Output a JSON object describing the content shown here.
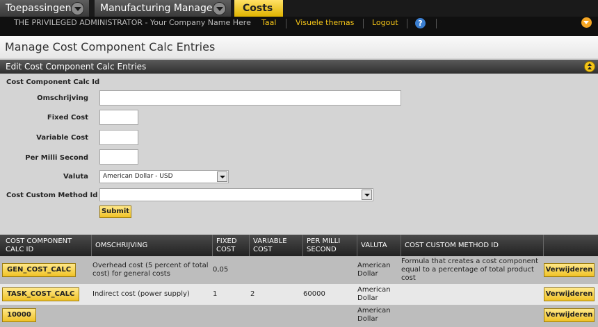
{
  "top_tabs": [
    {
      "label": "Toepassingen"
    },
    {
      "label": "Manufacturing Manager"
    },
    {
      "label": "Costs"
    }
  ],
  "header": {
    "user": "THE PRIVILEGED ADMINISTRATOR - Your Company Name Here",
    "links": [
      "Taal",
      "Visuele themas",
      "Logout"
    ],
    "help_glyph": "?"
  },
  "page": {
    "title": "Manage Cost Component Calc Entries"
  },
  "form": {
    "title": "Edit Cost Component Calc Entries",
    "fields": {
      "id_label": "Cost Component Calc Id",
      "description_label": "Omschrijving",
      "description_value": "",
      "fixed_cost_label": "Fixed Cost",
      "fixed_cost_value": "",
      "variable_cost_label": "Variable Cost",
      "variable_cost_value": "",
      "per_milli_label": "Per Milli Second",
      "per_milli_value": "",
      "currency_label": "Valuta",
      "currency_value": "American Dollar - USD",
      "custom_method_label": "Cost Custom Method Id",
      "custom_method_value": ""
    },
    "submit_label": "Submit"
  },
  "table": {
    "headers": [
      "COST COMPONENT CALC ID",
      "OMSCHRIJVING",
      "FIXED COST",
      "VARIABLE COST",
      "PER MILLI SECOND",
      "VALUTA",
      "COST CUSTOM METHOD ID",
      ""
    ],
    "rows": [
      {
        "id": "GEN_COST_CALC",
        "description": "Overhead cost (5 percent of total cost) for general costs",
        "fixed": "0,05",
        "variable": "",
        "per_milli": "",
        "currency": "American Dollar",
        "method": "Formula that creates a cost component equal to a percentage of total product cost",
        "delete": "Verwijderen"
      },
      {
        "id": "TASK_COST_CALC",
        "description": "Indirect cost (power supply)",
        "fixed": "1",
        "variable": "2",
        "per_milli": "60000",
        "currency": "American Dollar",
        "method": "",
        "delete": "Verwijderen"
      },
      {
        "id": "10000",
        "description": "",
        "fixed": "",
        "variable": "",
        "per_milli": "",
        "currency": "American Dollar",
        "method": "",
        "delete": "Verwijderen"
      }
    ]
  },
  "icons": {
    "tab_dropdown": "chevron-down-icon",
    "help": "help-icon",
    "menu": "chevron-down-icon",
    "collapse": "double-chevron-up-icon",
    "select_arrow": "chevron-down-icon"
  },
  "colors": {
    "accent_yellow": "#f5c518",
    "header_dark": "#1a1a1a",
    "row_dark": "#bdbdbd",
    "row_light": "#e8e8e8"
  }
}
